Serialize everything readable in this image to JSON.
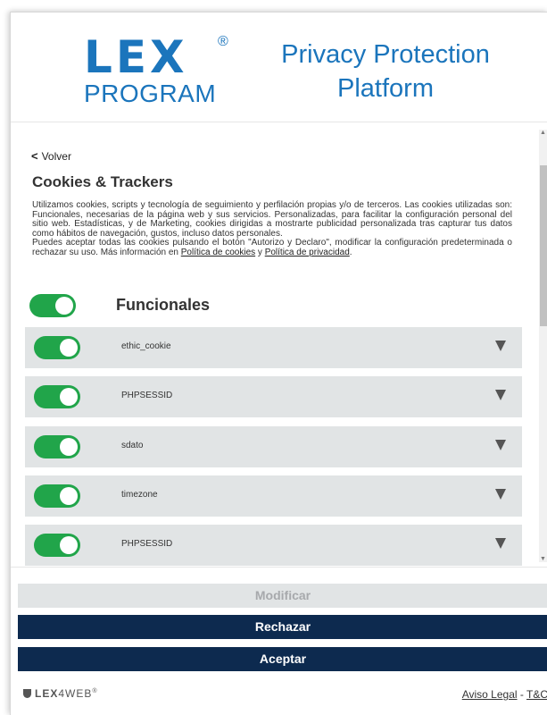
{
  "header": {
    "logo_text": "LEX",
    "logo_reg": "®",
    "logo_sub": "PROGRAM",
    "title_line1": "Privacy Protection",
    "title_line2": "Platform"
  },
  "content": {
    "back_label": "Volver",
    "section_title": "Cookies & Trackers",
    "description_p1": "Utilizamos cookies, scripts y tecnología de seguimiento y perfilación propias y/o de terceros. Las cookies utilizadas son: Funcionales, necesarias de la página web y sus servicios. Personalizadas, para facilitar la configuración personal del sitio web. Estadísticas, y de Marketing, cookies dirigidas a mostrarte publicidad personalizada tras capturar tus datos como hábitos de navegación, gustos, incluso datos personales.",
    "description_p2_start": "Puedes aceptar todas las cookies pulsando el botón \"Autorizo y Declaro\", modificar la configuración predeterminada o rechazar su uso. Más información en ",
    "cookie_policy_link": "Política de cookies",
    "and_text": " y ",
    "privacy_policy_link": "Política de privacidad",
    "period": ".",
    "group_label": "Funcionales",
    "group_enabled": true,
    "cookies": [
      {
        "name": "ethic_cookie",
        "enabled": true
      },
      {
        "name": "PHPSESSID",
        "enabled": true
      },
      {
        "name": "sdato",
        "enabled": true
      },
      {
        "name": "timezone",
        "enabled": true
      },
      {
        "name": "PHPSESSID",
        "enabled": true
      }
    ]
  },
  "buttons": {
    "modify": "Modificar",
    "reject": "Rechazar",
    "accept": "Aceptar"
  },
  "footer": {
    "brand_bold": "LEX",
    "brand_rest": "4WEB",
    "brand_reg": "®",
    "legal_link": "Aviso Legal",
    "separator": " - ",
    "tc_link": "T&C"
  },
  "colors": {
    "brand_blue": "#1b75bc",
    "toggle_green": "#21a54a",
    "button_navy": "#0d2a4f",
    "row_gray": "#e1e4e5"
  }
}
